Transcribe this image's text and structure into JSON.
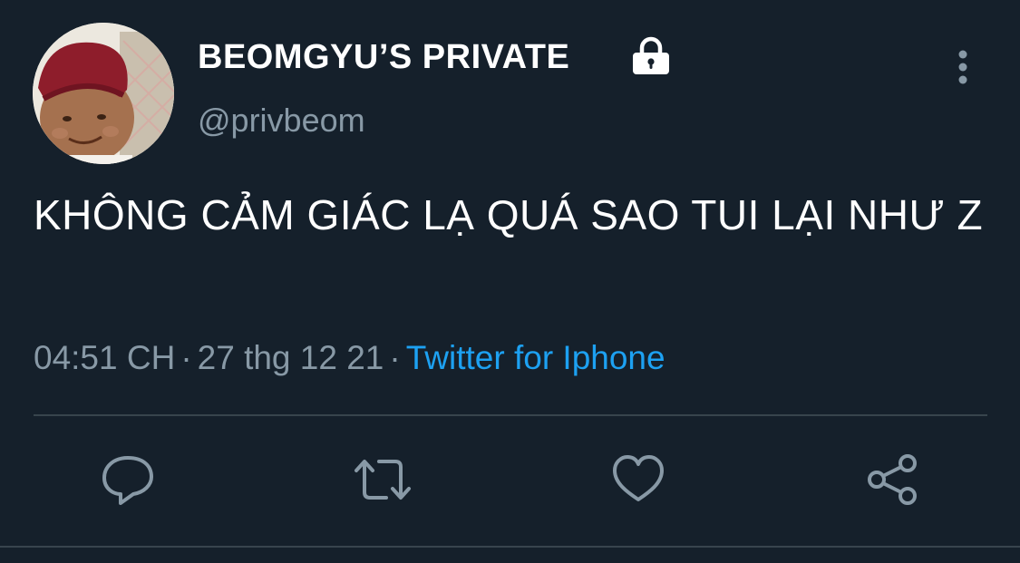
{
  "user": {
    "display_name": "BEOMGYU’S PRIVATE",
    "handle": "@privbeom",
    "protected_icon": "lock-icon",
    "avatar_icon": "avatar-photo"
  },
  "tweet": {
    "text": "KHÔNG CẢM GIÁC LẠ QUÁ SAO TUI LẠI NHƯ Z",
    "time": "04:51 CH",
    "separator": "·",
    "date": "27 thg 12 21",
    "source": "Twitter for Iphone"
  },
  "actions": [
    {
      "icon": "reply-icon"
    },
    {
      "icon": "retweet-icon"
    },
    {
      "icon": "like-icon"
    },
    {
      "icon": "share-icon"
    }
  ],
  "menu_icon": "more-vertical-icon",
  "colors": {
    "background": "#15202b",
    "text": "#ffffff",
    "secondary": "#8899a6",
    "accent": "#1da1f2",
    "divider": "#38444d"
  }
}
